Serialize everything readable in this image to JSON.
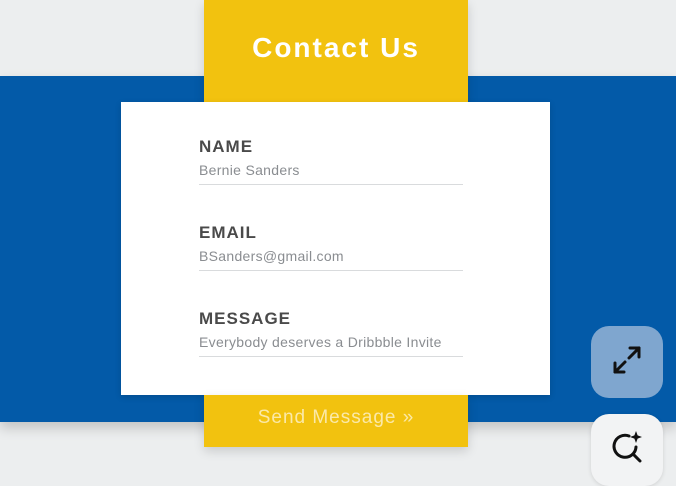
{
  "header": {
    "title": "Contact Us"
  },
  "form": {
    "fields": [
      {
        "label": "NAME",
        "value": "Bernie Sanders"
      },
      {
        "label": "EMAIL",
        "value": "BSanders@gmail.com"
      },
      {
        "label": "MESSAGE",
        "value": "Everybody deserves a Dribbble Invite"
      }
    ],
    "submit_label": "Send Message »"
  },
  "floating_buttons": [
    {
      "icon": "expand-icon"
    },
    {
      "icon": "ai-search-icon"
    }
  ],
  "colors": {
    "accent_yellow": "#f2c20f",
    "band_blue": "#035aa8",
    "background": "#eceeef",
    "card": "#ffffff",
    "label_text": "#4a4a4a",
    "value_text": "#8a8d91"
  }
}
